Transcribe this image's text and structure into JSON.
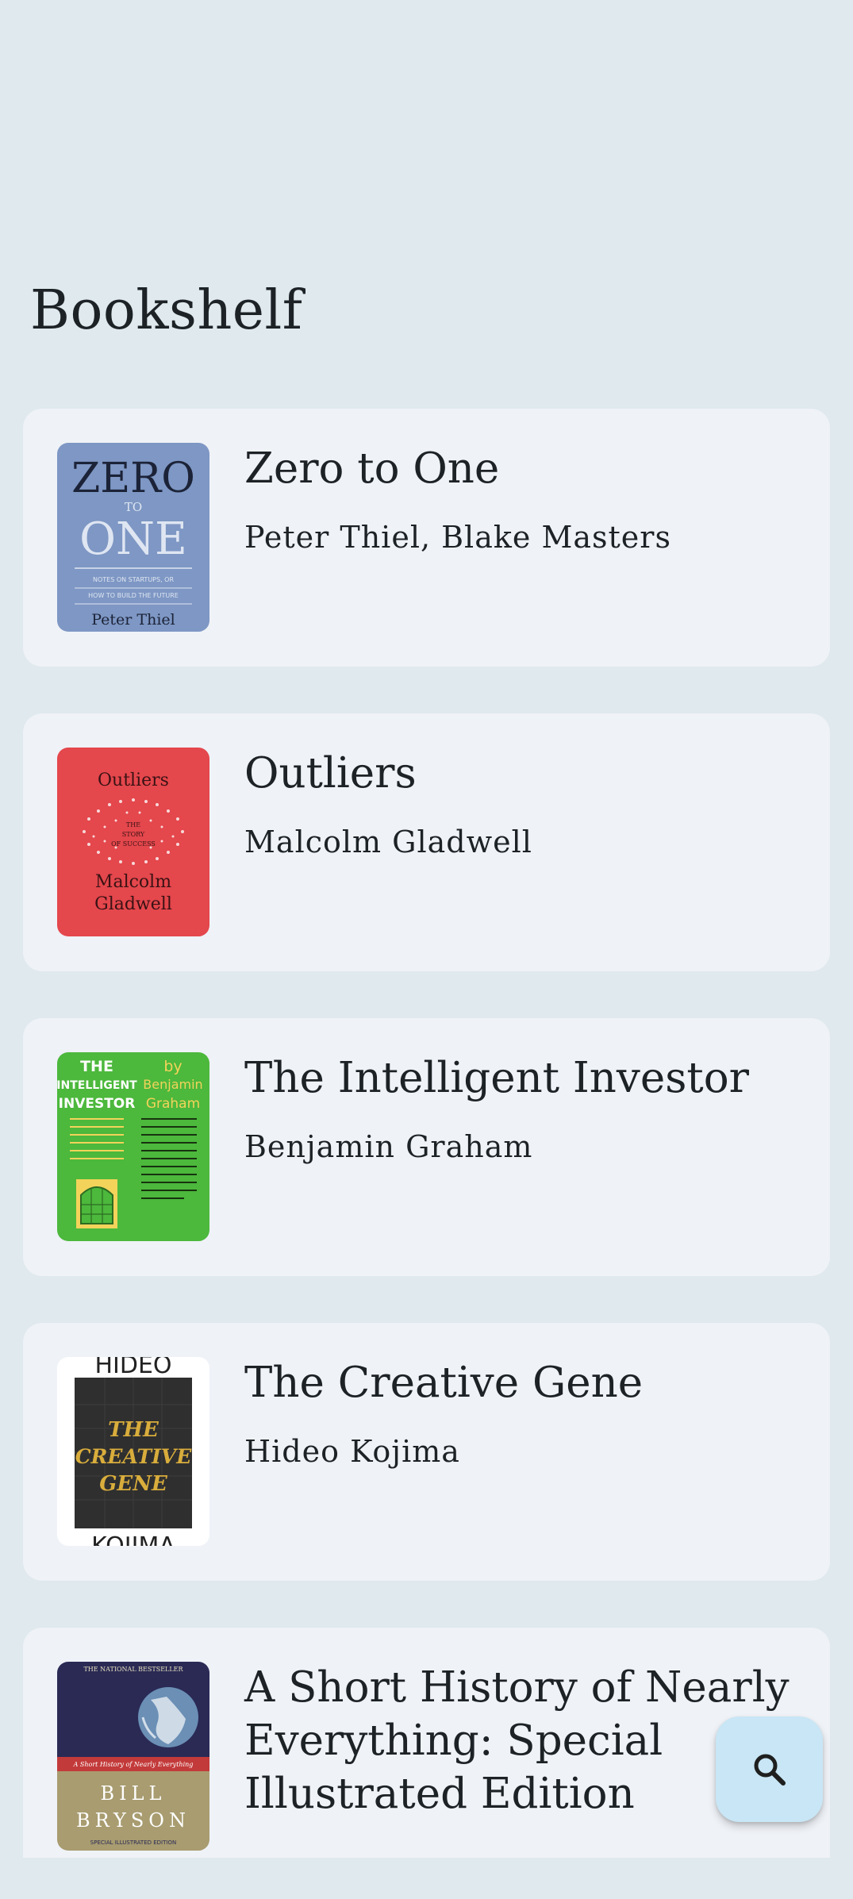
{
  "header": {
    "title": "Bookshelf"
  },
  "books": [
    {
      "title": "Zero to One",
      "author": "Peter Thiel, Blake Masters",
      "cover": {
        "big1": "ZERO",
        "small": "TO",
        "big2": "ONE",
        "tag": "NOTES ON STARTUPS, OR",
        "tag2": "HOW TO BUILD THE FUTURE",
        "author": "Peter Thiel",
        "color": "#7e97c4"
      }
    },
    {
      "title": "Outliers",
      "author": "Malcolm Gladwell",
      "cover": {
        "title": "Outliers",
        "sub1": "THE",
        "sub2": "STORY",
        "sub3": "OF SUCCESS",
        "author1": "Malcolm",
        "author2": "Gladwell",
        "color": "#e4474c"
      }
    },
    {
      "title": "The Intelligent Investor",
      "author": "Benjamin Graham",
      "cover": {
        "line1": "THE",
        "line2": "INTELLIGENT",
        "line3": "INVESTOR",
        "by": "by",
        "author1": "Benjamin",
        "author2": "Graham",
        "color": "#4cb83c"
      }
    },
    {
      "title": "The Creative Gene",
      "author": "Hideo Kojima",
      "cover": {
        "top": "HIDEO",
        "line1": "THE",
        "line2": "CREATIVE",
        "line3": "GENE",
        "bottom": "KOJIMA",
        "color": "#2f2f2f"
      }
    },
    {
      "title": "A Short History of Nearly Everything: Special Illustrated Edition",
      "author": "",
      "cover": {
        "banner": "THE NATIONAL BESTSELLER",
        "strip": "A Short History of Nearly Everything",
        "author1": "BILL",
        "author2": "BRYSON",
        "footer": "SPECIAL ILLUSTRATED EDITION",
        "color": "#2a2a55"
      }
    }
  ],
  "fab": {
    "icon": "search-icon",
    "color": "#c8e6f5"
  }
}
